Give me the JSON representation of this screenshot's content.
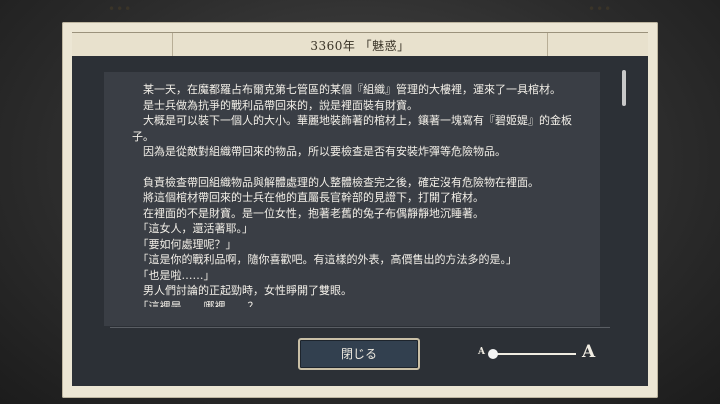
{
  "dialog": {
    "title": "3360年 「魅惑」",
    "title_dots_left": "•••",
    "title_dots_right": "•••"
  },
  "text_lines": [
    "　某一天，在魔都羅占布爾克第七管區的某個『組織』管理的大樓裡，運來了一具棺材。",
    "　是士兵做為抗爭的戰利品帶回來的，說是裡面裝有財寶。",
    "　大概是可以裝下一個人的大小。華麗地裝飾著的棺材上，鑲著一塊寫有『碧姬媞』的金板",
    "子。",
    "　因為是從敵對組織帶回來的物品，所以要檢查是否有安裝炸彈等危險物品。",
    "",
    "　負責檢查帶回組織物品與解體處理的人整體檢查完之後，確定沒有危險物在裡面。",
    "　將這個棺材帶回來的士兵在他的直屬長官幹部的見證下，打開了棺材。",
    "　在裡面的不是財寶。是一位女性，抱著老舊的兔子布偶靜靜地沉睡著。",
    "　「這女人，還活著耶。」",
    "　「要如何處理呢？」",
    "　「這是你的戰利品啊，隨你喜歡吧。有這樣的外表，高價售出的方法多的是。」",
    "　「也是啦……」",
    "　男人們討論的正起勁時，女性睜開了雙眼。",
    "　「這裡是……哪裡……？"
  ],
  "buttons": {
    "close_label": "閉じる"
  },
  "font_size_control": {
    "small_label": "A",
    "large_label": "A",
    "value": 0
  }
}
